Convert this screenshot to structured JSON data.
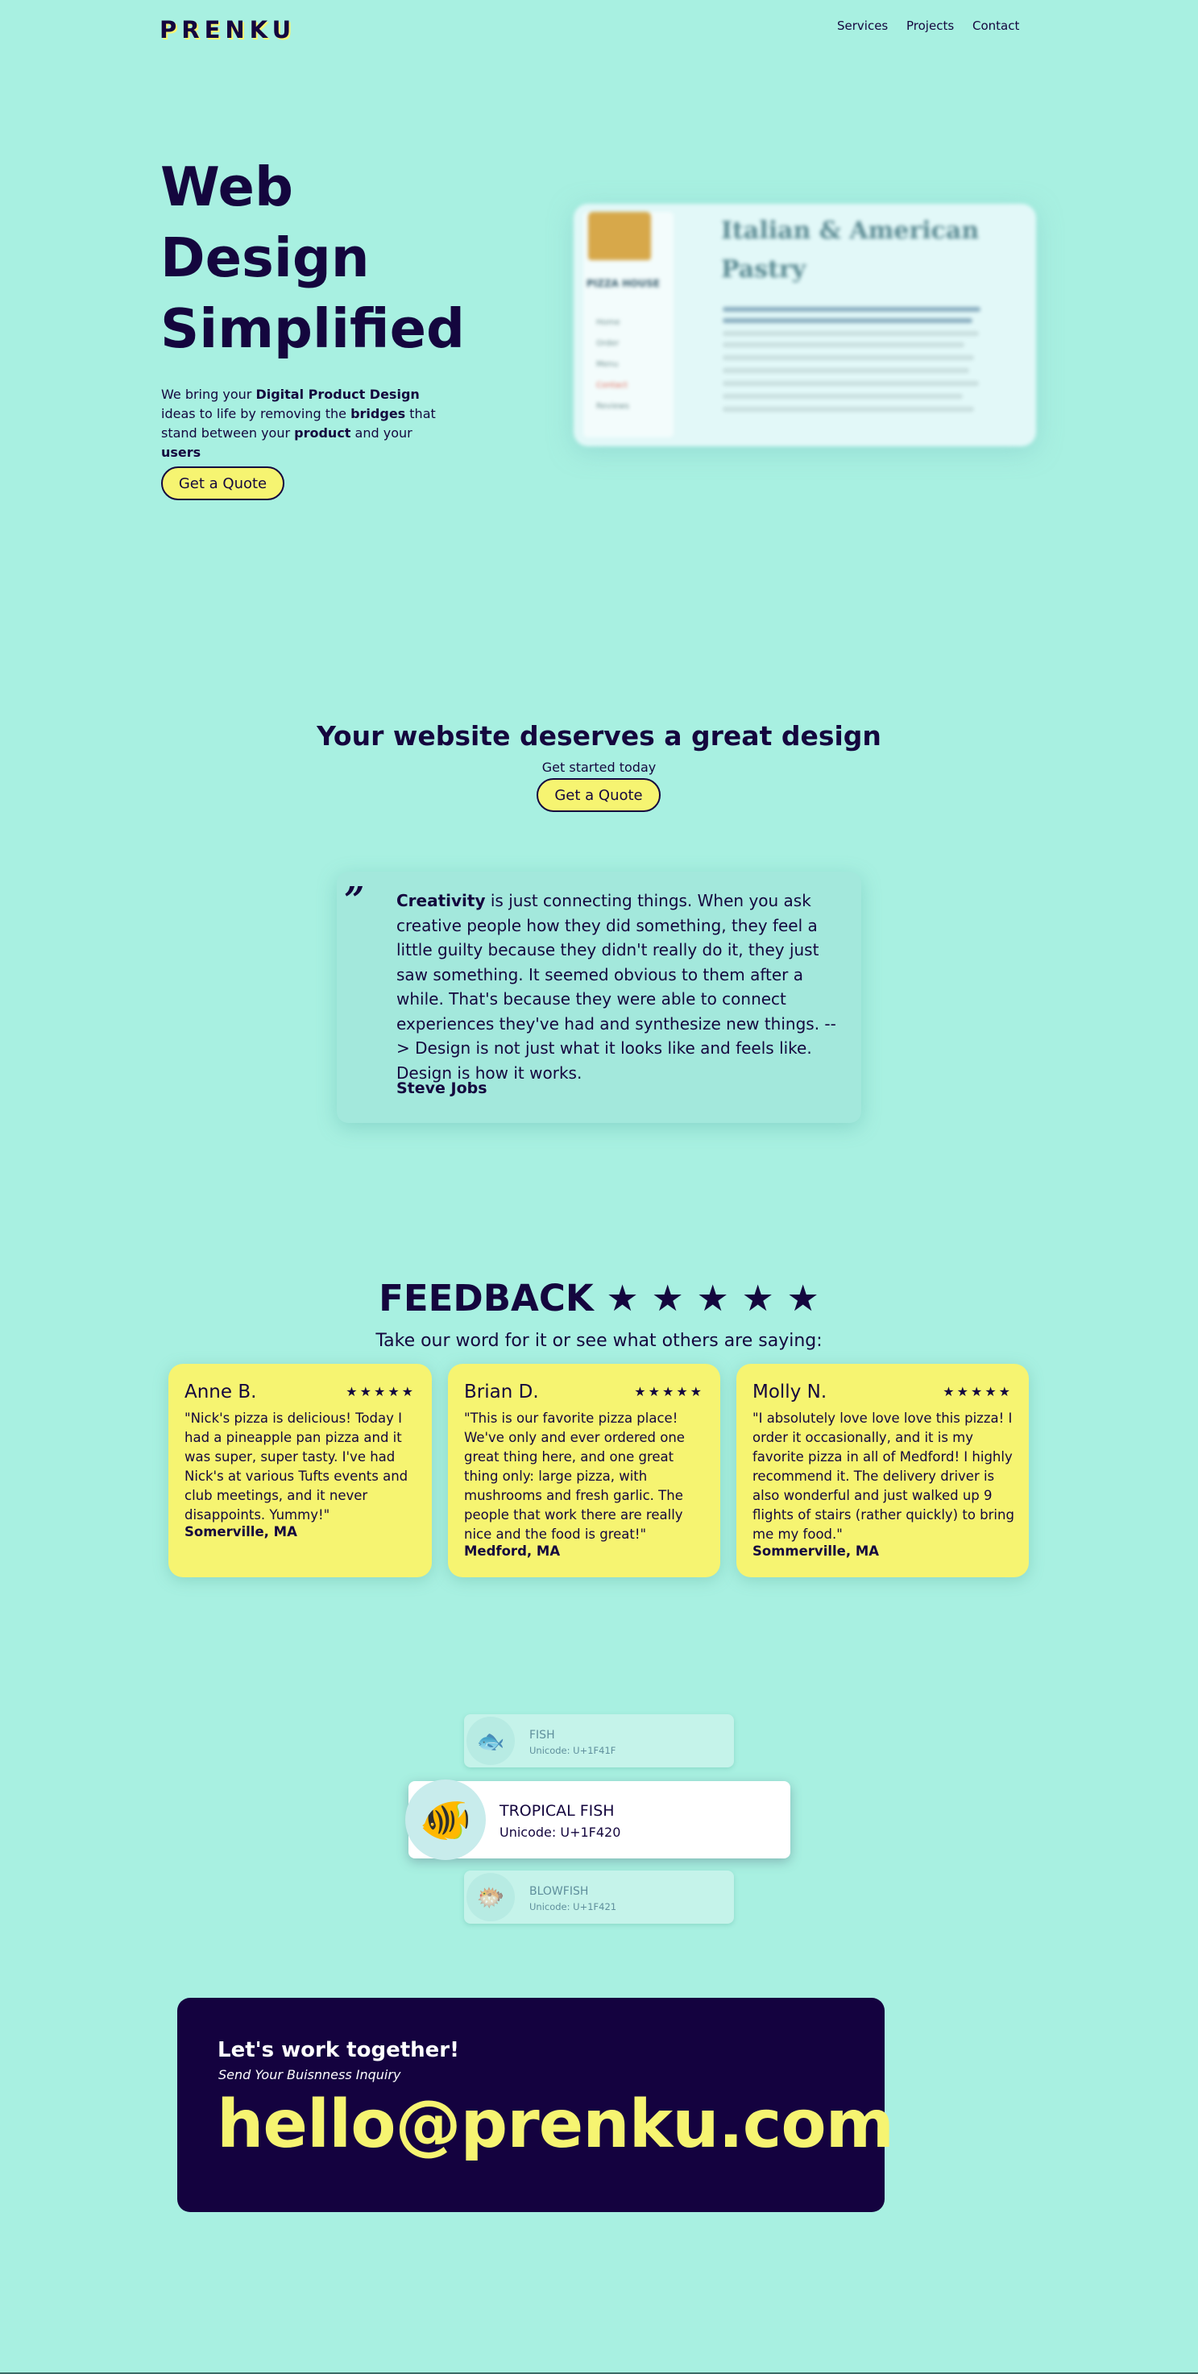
{
  "nav": {
    "logo": "PRENKU",
    "links": [
      "Services",
      "Projects",
      "Contact"
    ]
  },
  "hero": {
    "title_lines": [
      "Web",
      "Design",
      "Simplified"
    ],
    "desc": {
      "p1": "We bring your ",
      "b1": "Digital Product Design",
      "p2": " ideas to life by removing the ",
      "b2": "bridges",
      "p3": " that stand between your ",
      "b3": "product",
      "p4": " and your ",
      "b4": "users"
    },
    "button": "Get a Quote",
    "preview": {
      "title": "Italian & American Pastry",
      "side_label": "PIZZA HOUSE",
      "side_items": [
        "Home",
        "Order",
        "Menu",
        "Contact",
        "Reviews"
      ]
    }
  },
  "cta": {
    "title": "Your website deserves a great design",
    "subtitle": "Get started today",
    "button": "Get a Quote"
  },
  "quote": {
    "mark": "”",
    "bold": "Creativity",
    "text": " is just connecting things. When you ask creative people how they did something, they feel a little guilty because they didn't really do it, they just saw something. It seemed obvious to them after a while. That's because they were able to connect experiences they've had and synthesize new things. --> Design is not just what it looks like and feels like. Design is how it works.",
    "author": "Steve Jobs"
  },
  "feedback": {
    "title": "FEEDBACK ★ ★ ★ ★ ★",
    "subtitle": "Take our word for it or see what others are saying:",
    "reviews": [
      {
        "name": "Anne B.",
        "stars": "★★★★★",
        "text": "\"Nick's pizza is delicious! Today I had a pineapple pan pizza and it was super, super tasty. I've had Nick's at various Tufts events and club meetings, and it never disappoints. Yummy!\"",
        "location": "Somerville, MA"
      },
      {
        "name": "Brian D.",
        "stars": "★★★★★",
        "text": "\"This is our favorite pizza place! We've only and ever ordered one great thing here, and one great thing only: large pizza, with mushrooms and fresh garlic. The people that work there are really nice and the food is great!\"",
        "location": "Medford, MA"
      },
      {
        "name": "Molly N.",
        "stars": "★★★★★",
        "text": "\"I absolutely love love love this pizza! I order it occasionally, and it is my favorite pizza in all of Medford! I highly recommend it. The delivery driver is also wonderful and just walked up 9 flights of stairs (rather quickly) to bring me my food.\"",
        "location": "Sommerville, MA"
      }
    ]
  },
  "fish": [
    {
      "name": "FISH",
      "code": "Unicode: U+1F41F",
      "emoji": "🐟"
    },
    {
      "name": "TROPICAL FISH",
      "code": "Unicode: U+1F420",
      "emoji": "🐠"
    },
    {
      "name": "BLOWFISH",
      "code": "Unicode: U+1F421",
      "emoji": "🐡"
    }
  ],
  "contact": {
    "title": "Let's work together!",
    "subtitle": "Send Your Buisnness Inquiry",
    "email": "hello@prenku.com"
  },
  "colors": {
    "background": "#a8f0e1",
    "ink": "#14063e",
    "accent_yellow": "#f6f471",
    "contact_bg": "#14023f"
  }
}
